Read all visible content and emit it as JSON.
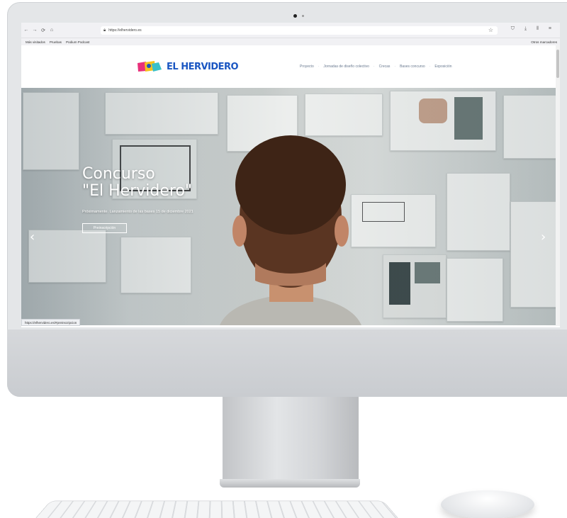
{
  "browser": {
    "nav_back": "←",
    "nav_forward": "→",
    "nav_reload": "⟳",
    "nav_home": "⌂",
    "url": "https://elhervidero.es",
    "toolbar_icons": "⛉ ⤓ ⫴ ≡",
    "bookmarks": [
      "Más visitados",
      "Pruebas",
      "Podium Podcast"
    ],
    "bookmarks_right": "Otros marcadores"
  },
  "site": {
    "logo_text": "EL HERVIDERO",
    "nav": [
      "Proyecto",
      "Jornadas de diseño colectivo",
      "Crecas",
      "Bases concurso",
      "Exposición"
    ],
    "hero": {
      "title_line1": "Concurso",
      "title_line2": "\"El Hervidero\"",
      "subtitle": "Próximamente. Lanzamiento de las bases 15 de diciembre 2021",
      "button_label": "Preinscripción",
      "arrow_left": "‹",
      "arrow_right": "›"
    },
    "status_url": "https://elhervidero.es/#preinscripcion"
  },
  "colors": {
    "logo_blue": "#1a56c2",
    "logo_yellow": "#f6c21c",
    "logo_pink": "#e8307a",
    "logo_teal": "#39c0c8"
  }
}
